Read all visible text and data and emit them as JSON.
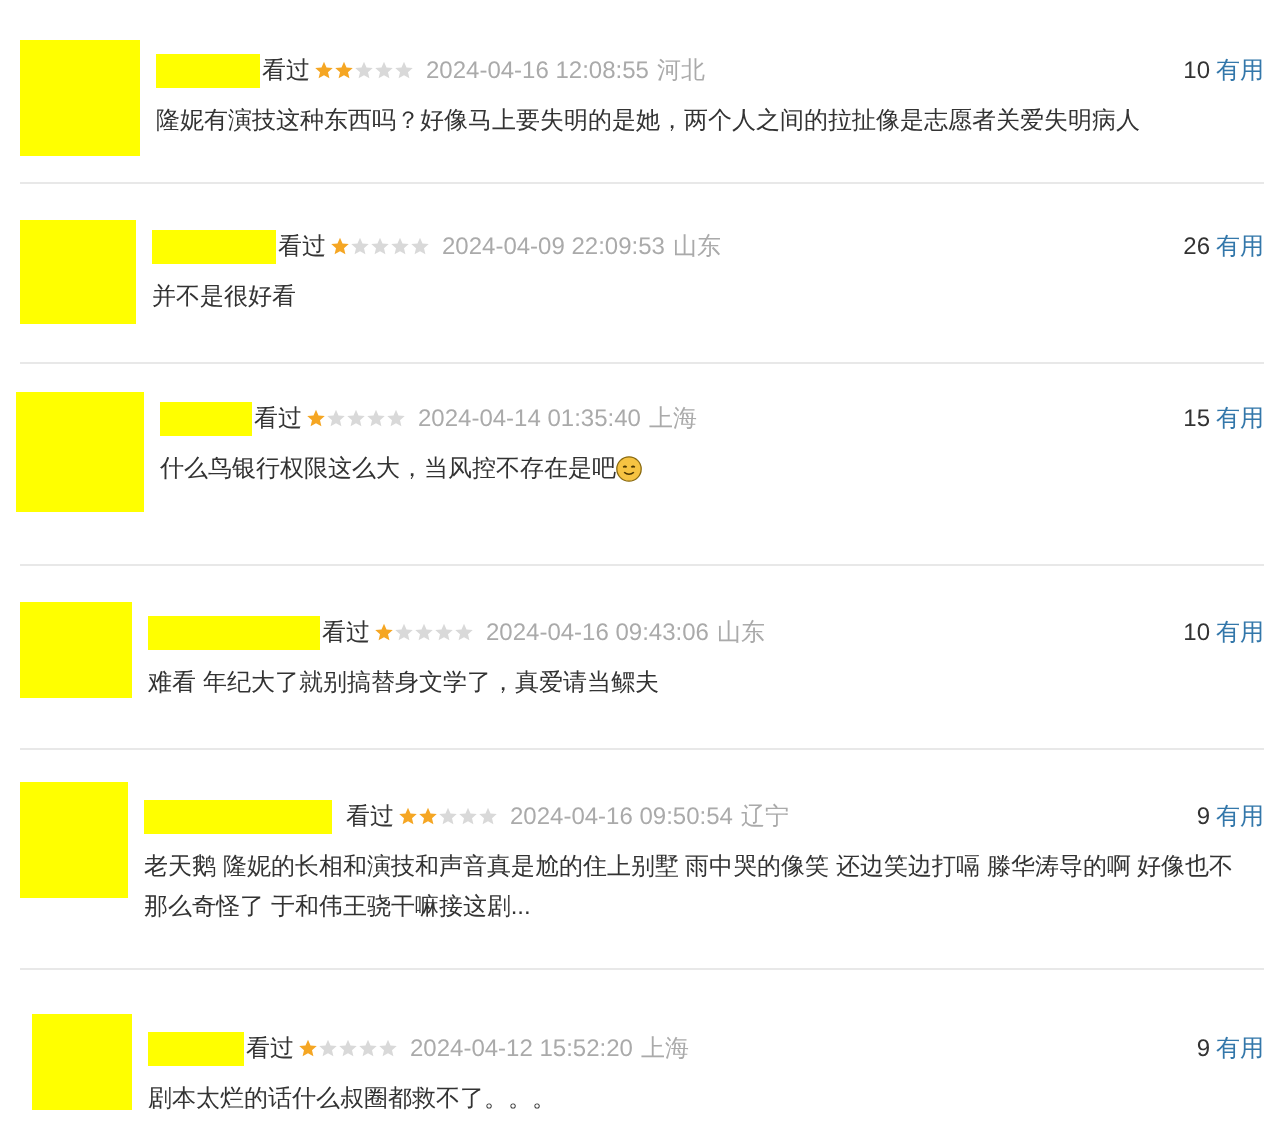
{
  "reviews": [
    {
      "status": "看过",
      "stars": 2,
      "time": "2024-04-16 12:08:55",
      "location": "河北",
      "votes": "10",
      "useful": "有用",
      "text": "隆妮有演技这种东西吗？好像马上要失明的是她，两个人之间的拉扯像是志愿者关爱失明病人"
    },
    {
      "status": "看过",
      "stars": 1,
      "time": "2024-04-09 22:09:53",
      "location": "山东",
      "votes": "26",
      "useful": "有用",
      "text": "并不是很好看"
    },
    {
      "status": "看过",
      "stars": 1,
      "time": "2024-04-14 01:35:40",
      "location": "上海",
      "votes": "15",
      "useful": "有用",
      "text": "什么鸟银行权限这么大，当风控不存在是吧",
      "emoji": true
    },
    {
      "status": "看过",
      "stars": 1,
      "time": "2024-04-16 09:43:06",
      "location": "山东",
      "votes": "10",
      "useful": "有用",
      "text": "难看 年纪大了就别搞替身文学了，真爱请当鳏夫"
    },
    {
      "status": "看过",
      "stars": 2,
      "time": "2024-04-16 09:50:54",
      "location": "辽宁",
      "votes": "9",
      "useful": "有用",
      "text": "老天鹅 隆妮的长相和演技和声音真是尬的住上别墅 雨中哭的像笑 还边笑边打嗝 滕华涛导的啊 好像也不那么奇怪了 于和伟王骁干嘛接这剧..."
    },
    {
      "status": "看过",
      "stars": 1,
      "time": "2024-04-12 15:52:20",
      "location": "上海",
      "votes": "9",
      "useful": "有用",
      "text": "剧本太烂的话什么叔圈都救不了。。。"
    }
  ]
}
